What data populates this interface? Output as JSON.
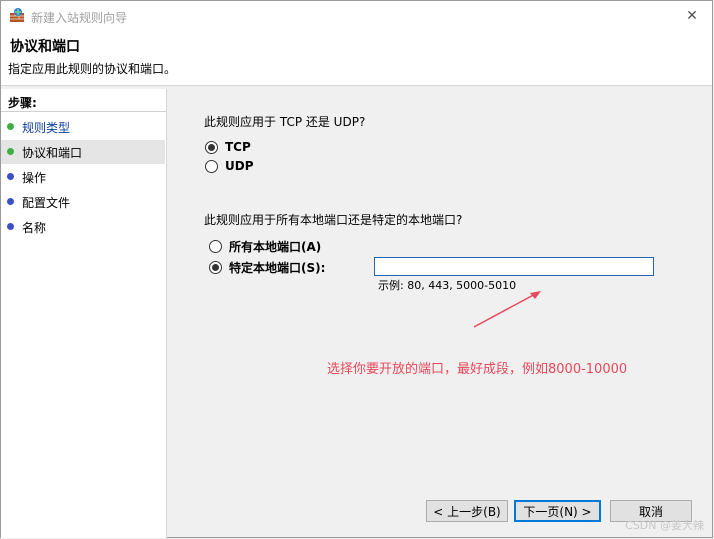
{
  "window": {
    "title": "新建入站规则向导",
    "close_glyph": "✕"
  },
  "header": {
    "title": "协议和端口",
    "description": "指定应用此规则的协议和端口。"
  },
  "sidebar": {
    "heading": "步骤:",
    "items": [
      {
        "label": "规则类型",
        "dot_color": "#3cb043",
        "link": true
      },
      {
        "label": "协议和端口",
        "dot_color": "#3cb043",
        "link": false,
        "active": true
      },
      {
        "label": "操作",
        "dot_color": "#3a4fc8",
        "link": false
      },
      {
        "label": "配置文件",
        "dot_color": "#3a4fc8",
        "link": false
      },
      {
        "label": "名称",
        "dot_color": "#3a4fc8",
        "link": false
      }
    ]
  },
  "main": {
    "protocol_question": "此规则应用于 TCP 还是 UDP?",
    "protocols": [
      {
        "label": "TCP",
        "selected": true
      },
      {
        "label": "UDP",
        "selected": false
      }
    ],
    "port_question": "此规则应用于所有本地端口还是特定的本地端口?",
    "port_options": [
      {
        "label": "所有本地端口(A)",
        "selected": false
      },
      {
        "label": "特定本地端口(S):",
        "selected": true
      }
    ],
    "port_value": "",
    "example": "示例: 80, 443, 5000-5010",
    "annotation": "选择你要开放的端口，最好成段，例如8000-10000"
  },
  "buttons": {
    "back": "< 上一步(B)",
    "next": "下一页(N) >",
    "cancel": "取消"
  },
  "colors": {
    "annotation": "#e8485b",
    "link": "#0f3e9c",
    "accent": "#0078d7"
  },
  "watermark": "CSDN @姜大辣"
}
